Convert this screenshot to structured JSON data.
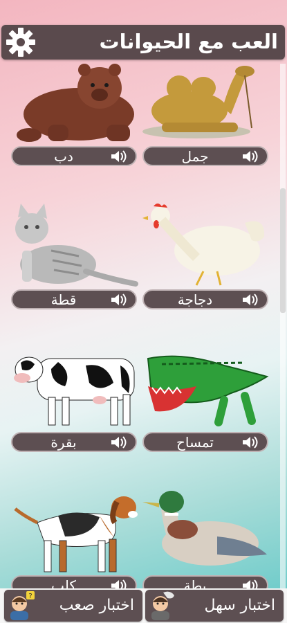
{
  "header": {
    "title": "العب مع الحيوانات",
    "settings_icon": "gear-icon"
  },
  "animals": [
    {
      "id": "bear",
      "name": "دب"
    },
    {
      "id": "camel",
      "name": "جمل"
    },
    {
      "id": "cat",
      "name": "قطة"
    },
    {
      "id": "chicken",
      "name": "دجاجة"
    },
    {
      "id": "cow",
      "name": "بقرة"
    },
    {
      "id": "crocodile",
      "name": "تمساح"
    },
    {
      "id": "dog",
      "name": "كلب"
    },
    {
      "id": "duck",
      "name": "بطة"
    }
  ],
  "quiz": {
    "hard_label": "اختبار صعب",
    "easy_label": "اختبار سهل"
  },
  "colors": {
    "bar": "#5a4a4d",
    "pill": "#5d4f52"
  }
}
